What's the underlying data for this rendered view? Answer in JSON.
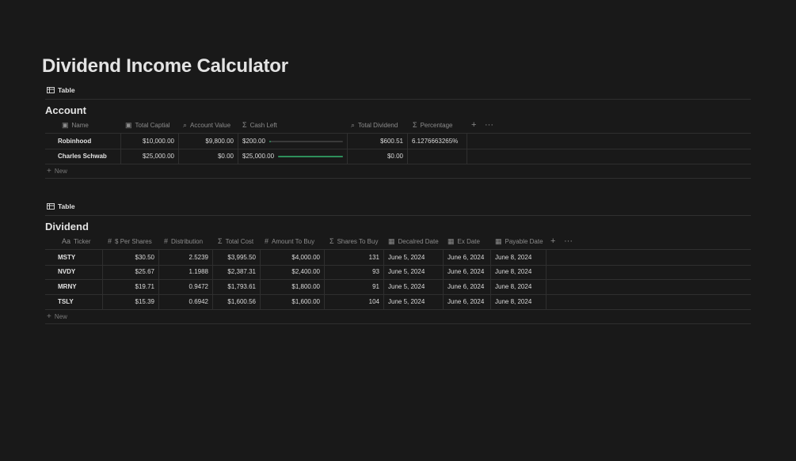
{
  "page": {
    "title": "Dividend Income Calculator"
  },
  "account": {
    "view_label": "Table",
    "title": "Account",
    "columns": [
      "Name",
      "Total Captial",
      "Account Value",
      "Cash Left",
      "Total Dividend",
      "Percentage"
    ],
    "rows": [
      {
        "name": "Robinhood",
        "total_capital": "$10,000.00",
        "account_value": "$9,800.00",
        "cash_left": "$200.00",
        "cash_left_fraction": 0.02,
        "total_dividend": "$600.51",
        "percentage": "6.1276663265%"
      },
      {
        "name": "Charles Schwab",
        "total_capital": "$25,000.00",
        "account_value": "$0.00",
        "cash_left": "$25,000.00",
        "cash_left_fraction": 1.0,
        "total_dividend": "$0.00",
        "percentage": ""
      }
    ],
    "new_label": "New"
  },
  "dividend": {
    "view_label": "Table",
    "title": "Dividend",
    "columns": [
      "Ticker",
      "$ Per Shares",
      "Distribution",
      "Total Cost",
      "Amount To Buy",
      "Shares To Buy",
      "Decalred Date",
      "Ex Date",
      "Payable Date"
    ],
    "rows": [
      {
        "ticker": "MSTY",
        "per_share": "$30.50",
        "distribution": "2.5239",
        "total_cost": "$3,995.50",
        "amount_to_buy": "$4,000.00",
        "shares_to_buy": "131",
        "declared": "June 5, 2024",
        "ex_date": "June 6, 2024",
        "payable": "June 8, 2024"
      },
      {
        "ticker": "NVDY",
        "per_share": "$25.67",
        "distribution": "1.1988",
        "total_cost": "$2,387.31",
        "amount_to_buy": "$2,400.00",
        "shares_to_buy": "93",
        "declared": "June 5, 2024",
        "ex_date": "June 6, 2024",
        "payable": "June 8, 2024"
      },
      {
        "ticker": "MRNY",
        "per_share": "$19.71",
        "distribution": "0.9472",
        "total_cost": "$1,793.61",
        "amount_to_buy": "$1,800.00",
        "shares_to_buy": "91",
        "declared": "June 5, 2024",
        "ex_date": "June 6, 2024",
        "payable": "June 8, 2024"
      },
      {
        "ticker": "TSLY",
        "per_share": "$15.39",
        "distribution": "0.6942",
        "total_cost": "$1,600.56",
        "amount_to_buy": "$1,600.00",
        "shares_to_buy": "104",
        "declared": "June 5, 2024",
        "ex_date": "June 6, 2024",
        "payable": "June 8, 2024"
      }
    ],
    "new_label": "New"
  },
  "colors": {
    "background": "#191919",
    "progress_fill": "#2e8f5b",
    "border": "#2f2f2f"
  },
  "icons": [
    "table-icon",
    "briefcase-icon",
    "search-icon",
    "sigma-icon",
    "hash-icon",
    "text-icon",
    "calendar-icon",
    "plus-icon",
    "more-icon"
  ]
}
